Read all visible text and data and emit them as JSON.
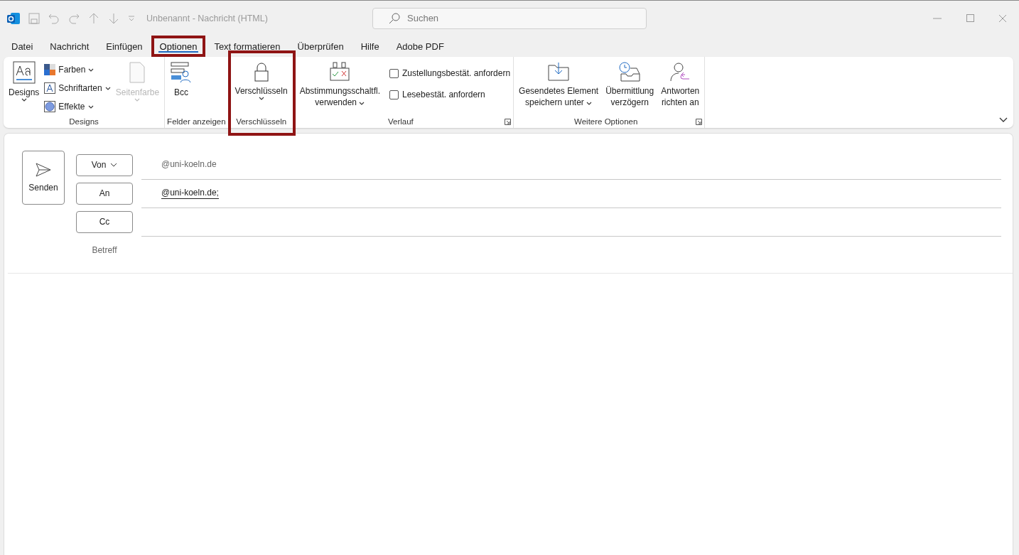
{
  "title_bar": {
    "title": "Unbenannt  -  Nachricht (HTML)",
    "search_placeholder": "Suchen"
  },
  "tabs": [
    {
      "label": "Datei",
      "selected": false,
      "highlighted": false
    },
    {
      "label": "Nachricht",
      "selected": false,
      "highlighted": false
    },
    {
      "label": "Einfügen",
      "selected": false,
      "highlighted": false
    },
    {
      "label": "Optionen",
      "selected": true,
      "highlighted": true
    },
    {
      "label": "Text formatieren",
      "selected": false,
      "highlighted": false
    },
    {
      "label": "Überprüfen",
      "selected": false,
      "highlighted": false
    },
    {
      "label": "Hilfe",
      "selected": false,
      "highlighted": false
    },
    {
      "label": "Adobe PDF",
      "selected": false,
      "highlighted": false
    }
  ],
  "ribbon": {
    "groups": [
      {
        "label": "Designs",
        "highlighted": false,
        "launcher": false,
        "items": [
          {
            "kind": "large",
            "lines": [
              "Designs"
            ],
            "dropdown": true,
            "disabled": false
          },
          {
            "kind": "stack",
            "items": [
              {
                "label": "Farben",
                "dropdown": true
              },
              {
                "label": "Schriftarten",
                "dropdown": true
              },
              {
                "label": "Effekte",
                "dropdown": true
              }
            ]
          },
          {
            "kind": "large",
            "lines": [
              "Seitenfarbe"
            ],
            "dropdown": true,
            "disabled": true
          }
        ]
      },
      {
        "label": "Felder anzeigen",
        "highlighted": false,
        "launcher": false,
        "items": [
          {
            "kind": "large",
            "lines": [
              "Bcc"
            ],
            "dropdown": false,
            "disabled": false
          }
        ]
      },
      {
        "label": "Verschlüsseln",
        "highlighted": true,
        "launcher": false,
        "items": [
          {
            "kind": "large",
            "lines": [
              "Verschlüsseln"
            ],
            "dropdown": true,
            "disabled": false
          }
        ]
      },
      {
        "label": "Verlauf",
        "highlighted": false,
        "launcher": true,
        "items": [
          {
            "kind": "large",
            "lines": [
              "Abstimmungsschaltfl.",
              "verwenden"
            ],
            "dropdown": true,
            "disabled": false
          },
          {
            "kind": "checks",
            "items": [
              {
                "label": "Zustellungsbestät. anfordern",
                "checked": false
              },
              {
                "label": "Lesebestät. anfordern",
                "checked": false
              }
            ]
          }
        ]
      },
      {
        "label": "Weitere Optionen",
        "highlighted": false,
        "launcher": true,
        "items": [
          {
            "kind": "large",
            "lines": [
              "Gesendetes Element",
              "speichern unter"
            ],
            "dropdown": true,
            "disabled": false
          },
          {
            "kind": "large",
            "lines": [
              "Übermittlung",
              "verzögern"
            ],
            "dropdown": false,
            "disabled": false
          },
          {
            "kind": "large",
            "lines": [
              "Antworten",
              "richten an"
            ],
            "dropdown": false,
            "disabled": false
          }
        ]
      }
    ]
  },
  "compose": {
    "send_label": "Senden",
    "fields": [
      {
        "kind": "dropdown",
        "label": "Von",
        "value": "@uni-koeln.de",
        "underlined": false
      },
      {
        "kind": "button",
        "label": "An",
        "value": "@uni-koeln.de;",
        "underlined": true
      },
      {
        "kind": "button",
        "label": "Cc"
      },
      {
        "kind": "plain",
        "label": "Betreff"
      }
    ]
  }
}
